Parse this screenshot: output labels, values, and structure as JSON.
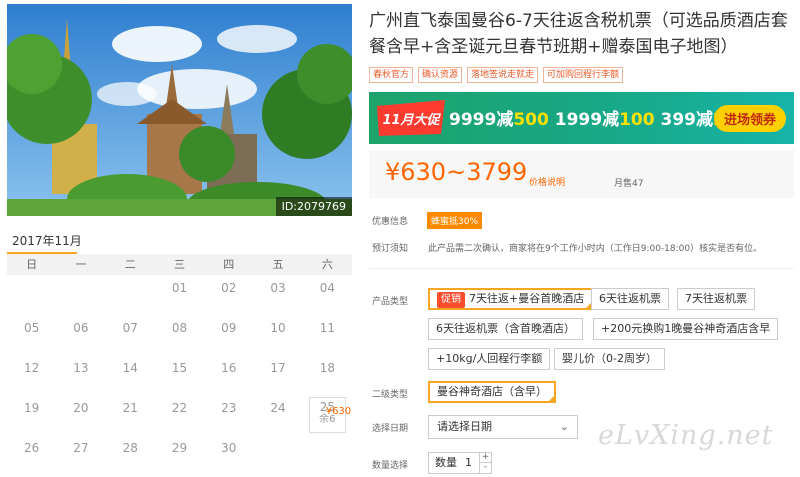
{
  "hero": {
    "image_desc": "Grand Palace temple with trees",
    "id_label": "ID:2079769"
  },
  "calendar": {
    "month": "2017年11月",
    "weekdays": [
      "日",
      "一",
      "二",
      "三",
      "四",
      "五",
      "六"
    ],
    "days": [
      "",
      "",
      "",
      "01",
      "02",
      "03",
      "04",
      "05",
      "06",
      "07",
      "08",
      "09",
      "10",
      "11",
      "12",
      "13",
      "14",
      "15",
      "16",
      "17",
      "18",
      "19",
      "20",
      "21",
      "22",
      "23",
      "24",
      "25",
      "26",
      "27",
      "28",
      "29",
      "30",
      "",
      ""
    ],
    "active_day": {
      "day": "25",
      "price": "¥630",
      "remaining": "余6"
    }
  },
  "product": {
    "title": "广州直飞泰国曼谷6-7天往返含税机票（可选品质酒店套餐含早+含圣诞元旦春节班期+赠泰国电子地图）",
    "tags": [
      "春秋官方",
      "确认资源",
      "落地签说走就走",
      "可加购回程行李额"
    ]
  },
  "promo": {
    "badge_text": "11月大促",
    "deals": [
      {
        "a": "9999减",
        "b": "500"
      },
      {
        "a": "1999减",
        "b": "100"
      },
      {
        "a": "399减",
        "b": "20"
      }
    ],
    "button": "进场领券",
    "colors": {
      "bg": "#1ea36b",
      "highlight": "#ffe100",
      "button": "#ffd000"
    }
  },
  "pricing": {
    "price": "¥630~3799",
    "note": "价格说明",
    "monthly_sales": "月售47"
  },
  "discount": {
    "label": "优惠信息",
    "badge": "蜂蜜抵30%"
  },
  "notice": {
    "label": "预订须知",
    "text": "此产品需二次确认，商家将在9个工作小时内（工作日9:00-18:00）核实是否有位。"
  },
  "product_type": {
    "label": "产品类型",
    "hot_badge": "促销",
    "options": [
      "7天往返+曼谷首晚酒店",
      "6天往返机票",
      "7天往返机票",
      "6天往返机票（含首晚酒店）",
      "+200元换购1晚曼谷神奇酒店含早",
      "+10kg/人回程行李额",
      "婴儿价（0-2周岁）"
    ]
  },
  "second_type": {
    "label": "二级类型",
    "option": "曼谷神奇酒店（含早）"
  },
  "date": {
    "label": "选择日期",
    "placeholder": "请选择日期"
  },
  "quantity": {
    "label": "数量选择",
    "field_label": "数量",
    "value": "1"
  },
  "watermark": "eLvXing.net"
}
